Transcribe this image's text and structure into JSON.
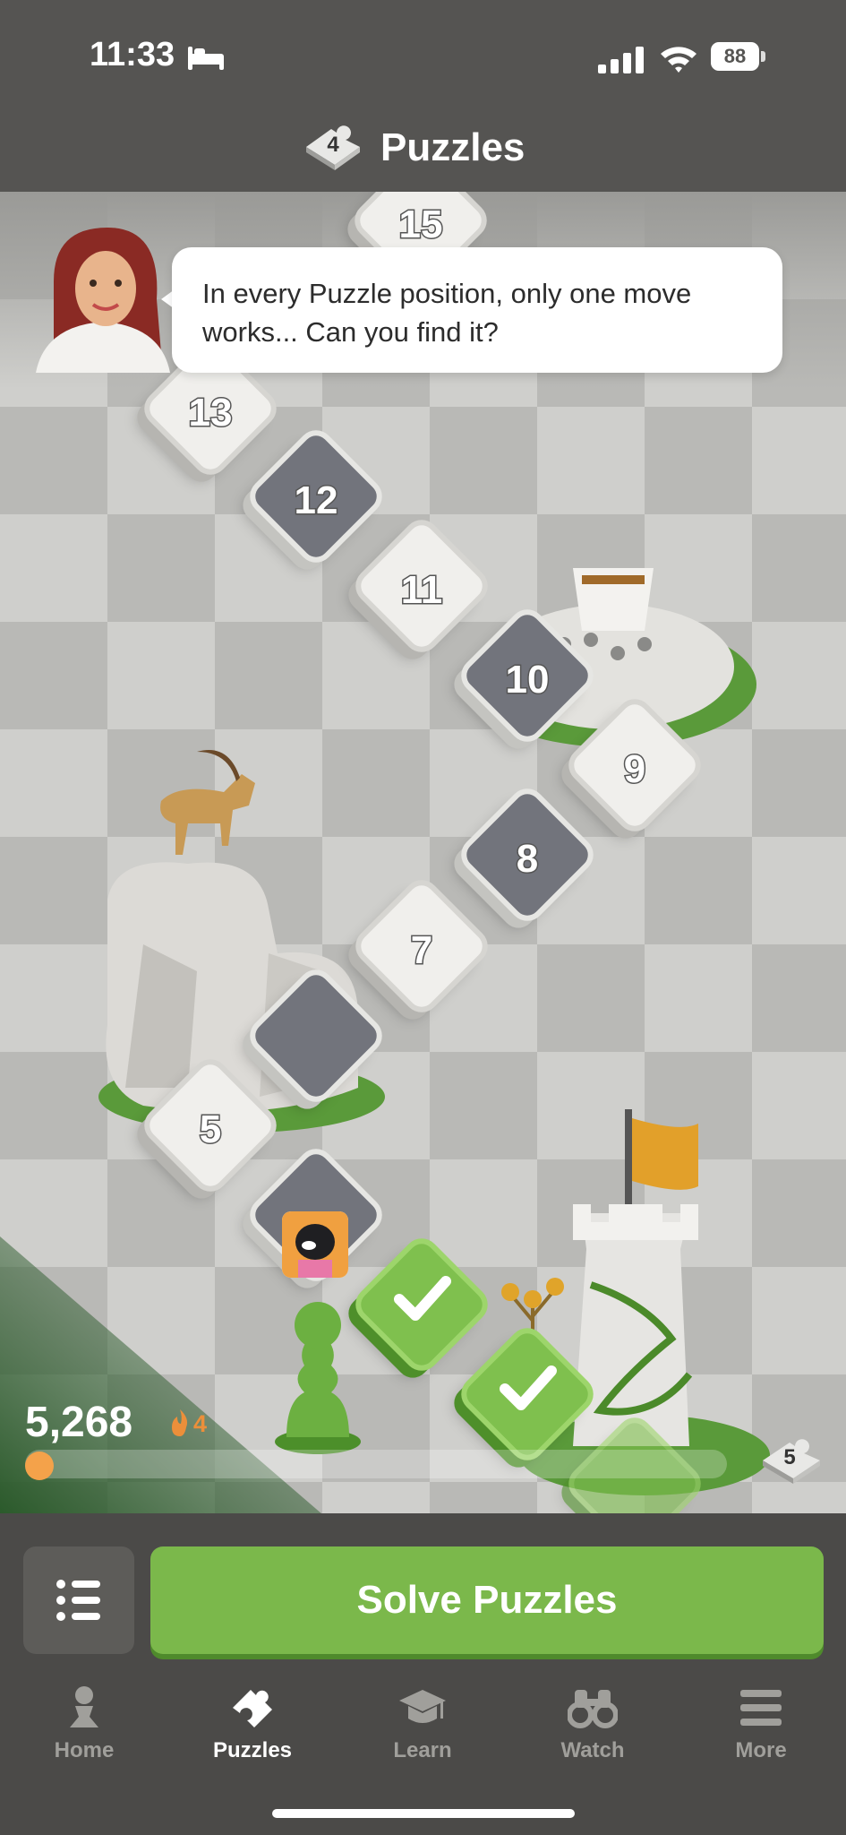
{
  "status_bar": {
    "time": "11:33",
    "battery": "88"
  },
  "header": {
    "title": "Puzzles",
    "badge_count": "4"
  },
  "coach_message": "In every Puzzle position, only one move works... Can you find it?",
  "path_tiles": [
    {
      "label": "15",
      "state": "locked"
    },
    {
      "label": "13",
      "state": "locked"
    },
    {
      "label": "12",
      "state": "locked"
    },
    {
      "label": "11",
      "state": "locked"
    },
    {
      "label": "10",
      "state": "locked"
    },
    {
      "label": "9",
      "state": "locked"
    },
    {
      "label": "8",
      "state": "locked"
    },
    {
      "label": "7",
      "state": "locked"
    },
    {
      "label": "5",
      "state": "locked"
    }
  ],
  "progress": {
    "score": "5,268",
    "streak": "4",
    "fill_fraction": 0.02,
    "next_badge": "5"
  },
  "actions": {
    "solve_label": "Solve Puzzles"
  },
  "tabs": [
    {
      "label": "Home",
      "icon": "pawn-icon"
    },
    {
      "label": "Puzzles",
      "icon": "puzzle-piece-icon",
      "active": true
    },
    {
      "label": "Learn",
      "icon": "graduation-cap-icon"
    },
    {
      "label": "Watch",
      "icon": "binoculars-icon"
    },
    {
      "label": "More",
      "icon": "menu-icon"
    }
  ],
  "colors": {
    "accent_green": "#7bb84b",
    "streak_orange": "#ec8f3a",
    "bar_bg": "#4b4a48"
  }
}
